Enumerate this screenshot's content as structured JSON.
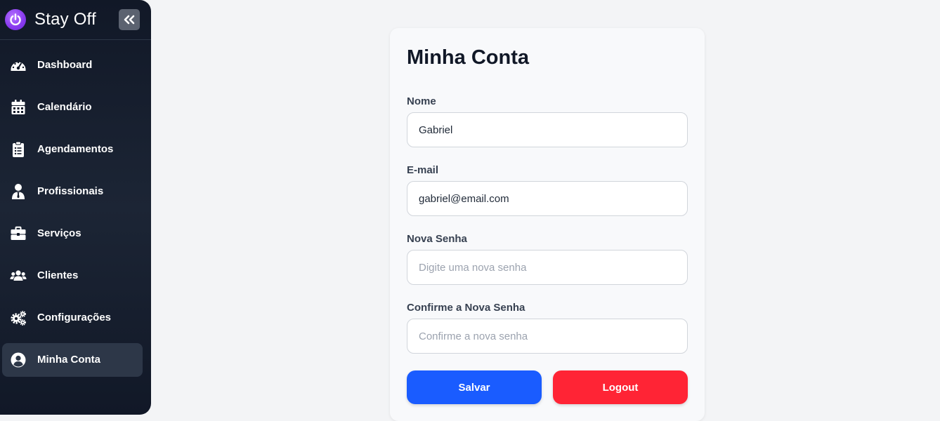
{
  "app": {
    "name": "Stay Off"
  },
  "sidebar": {
    "items": [
      {
        "label": "Dashboard",
        "icon": "dashboard-gauge-icon"
      },
      {
        "label": "Calendário",
        "icon": "calendar-icon"
      },
      {
        "label": "Agendamentos",
        "icon": "clipboard-icon"
      },
      {
        "label": "Profissionais",
        "icon": "professional-icon"
      },
      {
        "label": "Serviços",
        "icon": "briefcase-icon"
      },
      {
        "label": "Clientes",
        "icon": "users-icon"
      },
      {
        "label": "Configurações",
        "icon": "gears-icon"
      },
      {
        "label": "Minha Conta",
        "icon": "user-circle-icon",
        "active": true
      }
    ]
  },
  "account": {
    "title": "Minha Conta",
    "name": {
      "label": "Nome",
      "value": "Gabriel",
      "placeholder": ""
    },
    "email": {
      "label": "E-mail",
      "value": "gabriel@email.com",
      "placeholder": ""
    },
    "new_password": {
      "label": "Nova Senha",
      "value": "",
      "placeholder": "Digite uma nova senha"
    },
    "confirm_password": {
      "label": "Confirme a Nova Senha",
      "value": "",
      "placeholder": "Confirme a nova senha"
    },
    "save_label": "Salvar",
    "logout_label": "Logout"
  },
  "colors": {
    "sidebar_bg": "#111827",
    "brand_purple": "#8a3cf0",
    "save_button": "#1a5cff",
    "logout_button": "#ff2435"
  }
}
